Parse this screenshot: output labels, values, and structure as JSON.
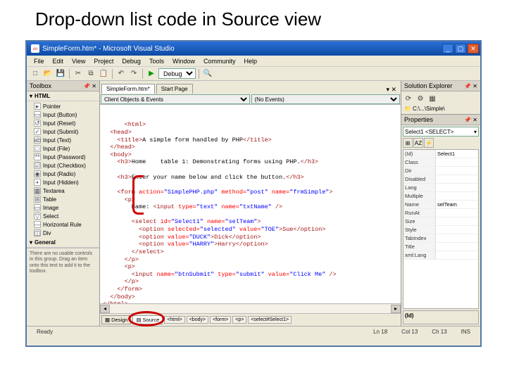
{
  "slide_title": "Drop-down list code in Source view",
  "window": {
    "title": "SimpleForm.htm* - Microsoft Visual Studio",
    "icon_glyph": "∞"
  },
  "menu": [
    "File",
    "Edit",
    "View",
    "Project",
    "Debug",
    "Tools",
    "Window",
    "Community",
    "Help"
  ],
  "toolbar_combo": "Debug",
  "toolbox": {
    "title": "Toolbox",
    "section": "HTML",
    "items": [
      {
        "icon": "▸",
        "label": "Pointer"
      },
      {
        "icon": "▭",
        "label": "Input (Button)"
      },
      {
        "icon": "↺",
        "label": "Input (Reset)"
      },
      {
        "icon": "✓",
        "label": "Input (Submit)"
      },
      {
        "icon": "ab",
        "label": "Input (Text)"
      },
      {
        "icon": "□",
        "label": "Input (File)"
      },
      {
        "icon": "**",
        "label": "Input (Password)"
      },
      {
        "icon": "☑",
        "label": "Input (Checkbox)"
      },
      {
        "icon": "◉",
        "label": "Input (Radio)"
      },
      {
        "icon": "▪",
        "label": "Input (Hidden)"
      },
      {
        "icon": "▦",
        "label": "Textarea"
      },
      {
        "icon": "⊞",
        "label": "Table"
      },
      {
        "icon": "▭",
        "label": "Image"
      },
      {
        "icon": "▽",
        "label": "Select"
      },
      {
        "icon": "—",
        "label": "Horizontal Rule"
      },
      {
        "icon": "◫",
        "label": "Div"
      }
    ],
    "general": "General",
    "desc": "There are no usable controls in this group. Drag an item onto this text to add it to the toolbox."
  },
  "doctabs": {
    "active": "SimpleForm.htm*",
    "inactive": "Start Page"
  },
  "dropbar": {
    "left": "Client Objects & Events",
    "right": "(No Events)"
  },
  "code": {
    "l1": "<html>",
    "l2": "  <head>",
    "l3_open": "    <title>",
    "l3_text": "A simple form handled by PHP",
    "l3_close": "</title>",
    "l4": "  </head>",
    "l5": "  <body>",
    "l6_open": "    <h3>",
    "l6_text": "Home    table 1: Demonstrating forms using PHP.",
    "l6_close": "</h3>",
    "l7": "",
    "l8_open": "    <h3>",
    "l8_text": "Enter your name below and click the button.",
    "l8_close": "</h3>",
    "l9": "",
    "l10a": "    <form ",
    "l10b": "action=",
    "l10c": "\"SimplePHP.php\"",
    "l10d": " method=",
    "l10e": "\"post\"",
    "l10f": " name=",
    "l10g": "\"frmSimple\"",
    "l10h": ">",
    "l11": "      <p>",
    "l12a": "        Name: ",
    "l12b": "<input ",
    "l12c": "type=",
    "l12d": "\"text\"",
    "l12e": " name=",
    "l12f": "\"txtName\"",
    "l12g": " />",
    "l13": "",
    "l14a": "        <select ",
    "l14b": "id=",
    "l14c": "\"Select1\"",
    "l14d": " name=",
    "l14e": "\"selTeam\"",
    "l14f": ">",
    "l15a": "          <option ",
    "l15b": "selected=",
    "l15c": "\"selected\"",
    "l15d": " value=",
    "l15e": "\"TOE\"",
    "l15f": ">Sue</option>",
    "l16a": "          <option ",
    "l16b": "value=",
    "l16c": "\"DUCK\"",
    "l16d": ">Dick</option>",
    "l17a": "          <option ",
    "l17b": "value=",
    "l17c": "\"HARRY\"",
    "l17d": ">Harry</option>",
    "l18": "        </select>",
    "l19": "      </p>",
    "l20": "      <p>",
    "l21a": "        <input ",
    "l21b": "name=",
    "l21c": "\"btnSubmit\"",
    "l21d": " type=",
    "l21e": "\"submit\"",
    "l21f": " value=",
    "l21g": "\"Click Me\"",
    "l21h": " />",
    "l22": "      </p>",
    "l23": "    </form>",
    "l24": "  </body>",
    "l25": "</html>"
  },
  "viewtabs": {
    "design": "Design",
    "source": "Source",
    "crumbs": [
      "<html>",
      "<body>",
      "<form>",
      "<p>",
      "<select#Select1>"
    ]
  },
  "solution": {
    "title": "Solution Explorer",
    "root": "C:\\...\\Simple\\"
  },
  "properties": {
    "title": "Properties",
    "object": "Select1  <SELECT>",
    "rows": [
      {
        "n": "(Id)",
        "v": "Select1"
      },
      {
        "n": "Class",
        "v": ""
      },
      {
        "n": "Dir",
        "v": ""
      },
      {
        "n": "Disabled",
        "v": ""
      },
      {
        "n": "Lang",
        "v": ""
      },
      {
        "n": "Multiple",
        "v": ""
      },
      {
        "n": "Name",
        "v": "selTeam"
      },
      {
        "n": "RunAt",
        "v": ""
      },
      {
        "n": "Size",
        "v": ""
      },
      {
        "n": "Style",
        "v": ""
      },
      {
        "n": "TabIndex",
        "v": ""
      },
      {
        "n": "Title",
        "v": ""
      },
      {
        "n": "xml:Lang",
        "v": ""
      }
    ],
    "desc_label": "(Id)"
  },
  "status": {
    "ready": "Ready",
    "ln": "Ln 18",
    "col": "Col 13",
    "ch": "Ch 13",
    "ins": "INS"
  }
}
